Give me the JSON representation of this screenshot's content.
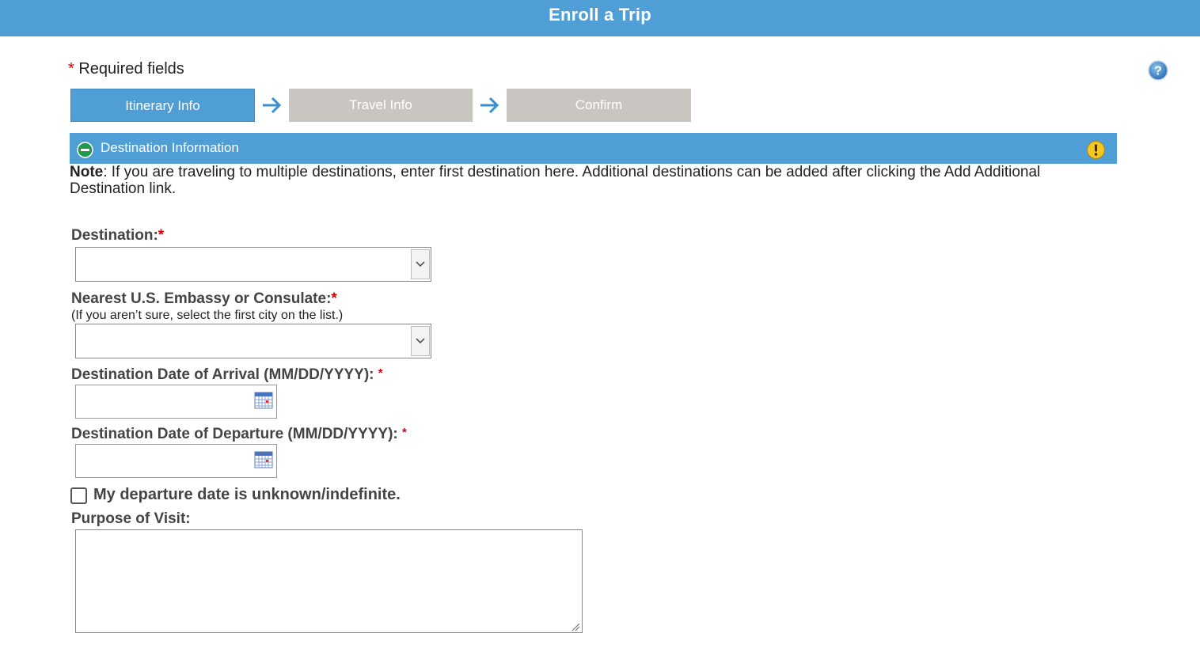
{
  "header": {
    "title": "Enroll a Trip"
  },
  "required_note": {
    "asterisk": "*",
    "text": "Required fields"
  },
  "steps": [
    {
      "label": "Itinerary Info",
      "state": "active"
    },
    {
      "label": "Travel Info",
      "state": "inactive"
    },
    {
      "label": "Confirm",
      "state": "inactive"
    }
  ],
  "section": {
    "title": "Destination Information"
  },
  "note": {
    "prefix": "Note",
    "text": ": If you are traveling to multiple destinations, enter first destination here. Additional destinations can be added after clicking the Add Additional Destination link."
  },
  "fields": {
    "destination": {
      "label": "Destination:",
      "asterisk": "*",
      "value": ""
    },
    "embassy": {
      "label": "Nearest U.S. Embassy or Consulate:",
      "asterisk": "*",
      "hint": "(If you aren’t sure, select the first city on the list.)",
      "value": ""
    },
    "arrival": {
      "label": "Destination Date of Arrival (MM/DD/YYYY):",
      "asterisk": "*",
      "value": ""
    },
    "departure": {
      "label": "Destination Date of Departure (MM/DD/YYYY):",
      "asterisk": "*",
      "value": ""
    },
    "unknown_departure": {
      "label": "My departure date is unknown/indefinite.",
      "checked": false
    },
    "purpose": {
      "label": "Purpose of Visit:",
      "value": ""
    }
  },
  "colors": {
    "primary": "#4f9fd6",
    "inactive_step": "#c9c6c1",
    "required": "#d40000",
    "warning": "#f3c623",
    "collapse": "#1e9b4c"
  },
  "icons": {
    "help": "question-mark-circle",
    "collapse": "minus-circle",
    "warning": "exclamation-circle",
    "step_arrow": "arrow-right",
    "calendar": "calendar",
    "dropdown": "chevron-down",
    "resize": "resize-grip"
  }
}
